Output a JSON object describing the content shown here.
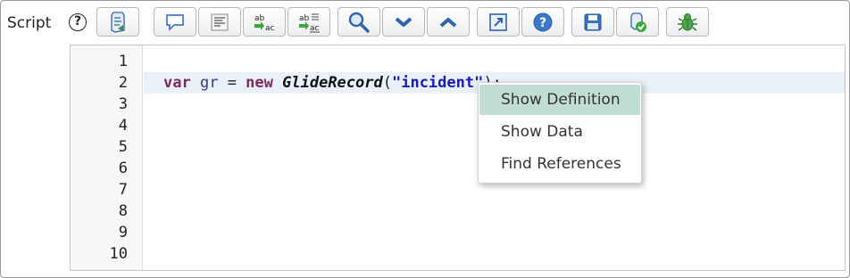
{
  "field": {
    "label": "Script",
    "help_icon": "?"
  },
  "toolbar": {
    "groups": [
      [
        "script-include-icon"
      ],
      [
        "comment-icon",
        "format-code-icon",
        "replace-icon",
        "replace-all-icon"
      ],
      [
        "search-icon",
        "chevron-down-icon",
        "chevron-up-icon"
      ],
      [
        "fullscreen-icon",
        "help-icon"
      ],
      [
        "save-icon",
        "validate-icon",
        "debug-icon"
      ]
    ]
  },
  "editor": {
    "line_numbers": [
      "1",
      "2",
      "3",
      "4",
      "5",
      "6",
      "7",
      "8",
      "9",
      "10"
    ],
    "active_line": 2,
    "code": {
      "kw_var": "var",
      "sp1": " ",
      "ident_gr": "gr",
      "op_eq": " = ",
      "kw_new": "new",
      "sp2": " ",
      "class_name": "GlideRecord",
      "paren_open": "(",
      "string_literal": "\"incident\"",
      "tail": ");"
    }
  },
  "context_menu": {
    "items": [
      "Show Definition",
      "Show Data",
      "Find References"
    ],
    "highlighted_index": 0
  },
  "colors": {
    "menu_highlight": "#c1ded3",
    "active_line": "#e9f0fa",
    "keyword": "#7d2a5c",
    "string": "#1a1ab8"
  }
}
